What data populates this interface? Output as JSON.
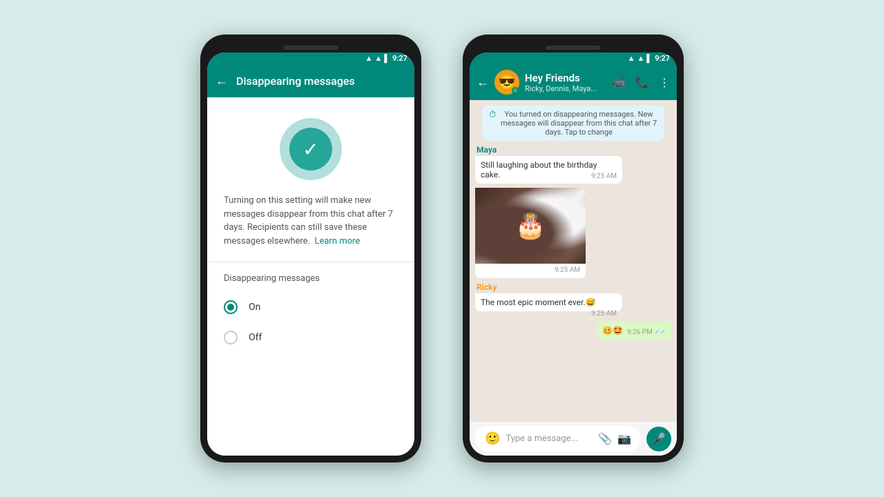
{
  "background": "#d6ecea",
  "phone1": {
    "status_bar": {
      "time": "9:27",
      "signal": "▲▲▲",
      "battery": "█"
    },
    "app_bar": {
      "title": "Disappearing messages",
      "back_label": "←"
    },
    "description": "Turning on this setting will make new messages disappear from this chat after 7 days. Recipients can still save these messages elsewhere.",
    "learn_more": "Learn more",
    "section_title": "Disappearing messages",
    "options": [
      {
        "id": "on",
        "label": "On",
        "selected": true
      },
      {
        "id": "off",
        "label": "Off",
        "selected": false
      }
    ]
  },
  "phone2": {
    "status_bar": {
      "time": "9:27"
    },
    "app_bar": {
      "back_label": "←",
      "chat_name": "Hey Friends",
      "chat_members": "Ricky, Dennis, Maya...",
      "emoji": "😎"
    },
    "system_message": "You turned on disappearing messages. New messages will disappear from this chat after 7 days. Tap to change",
    "messages": [
      {
        "type": "received",
        "sender": "Maya",
        "sender_color": "teal",
        "text": "Still laughing about the birthday cake.",
        "time": "9:25 AM",
        "has_image": false
      },
      {
        "type": "received",
        "sender": "Maya",
        "sender_color": "teal",
        "text": "",
        "time": "9:25 AM",
        "has_image": true
      },
      {
        "type": "received",
        "sender": "Ricky",
        "sender_color": "orange",
        "text": "The most epic moment ever.😅",
        "time": "9:25 AM",
        "has_image": false
      },
      {
        "type": "sent",
        "text": "🥴🤩",
        "time": "9:26 PM",
        "ticks": "✓✓"
      }
    ],
    "input_placeholder": "Type a message..."
  }
}
